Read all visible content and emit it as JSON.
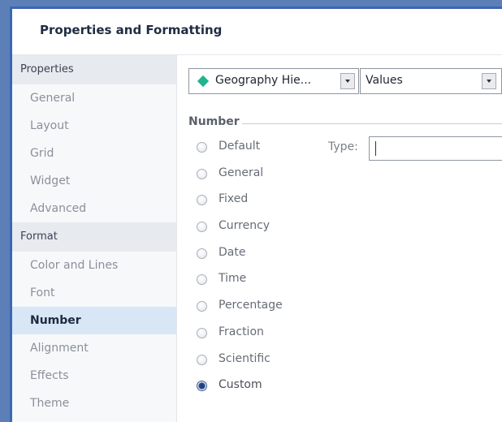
{
  "dialog": {
    "title": "Properties and Formatting"
  },
  "sidebar": {
    "sections": [
      {
        "label": "Properties",
        "items": [
          "General",
          "Layout",
          "Grid",
          "Widget",
          "Advanced"
        ]
      },
      {
        "label": "Format",
        "items": [
          "Color and Lines",
          "Font",
          "Number",
          "Alignment",
          "Effects",
          "Theme"
        ]
      }
    ],
    "selected": "Number"
  },
  "selectors": {
    "hierarchy_value": "Geography Hie...",
    "hierarchy_icon": "diamond-icon",
    "hierarchy_icon_color": "#1fb38e",
    "values_value": "Values"
  },
  "number": {
    "group_label": "Number",
    "type_label": "Type:",
    "type_value": "",
    "options": [
      "Default",
      "General",
      "Fixed",
      "Currency",
      "Date",
      "Time",
      "Percentage",
      "Fraction",
      "Scientific",
      "Custom"
    ],
    "selected": "Custom"
  },
  "colors": {
    "window_border": "#3c67b2",
    "selected_item_bg": "#d8e6f6"
  }
}
